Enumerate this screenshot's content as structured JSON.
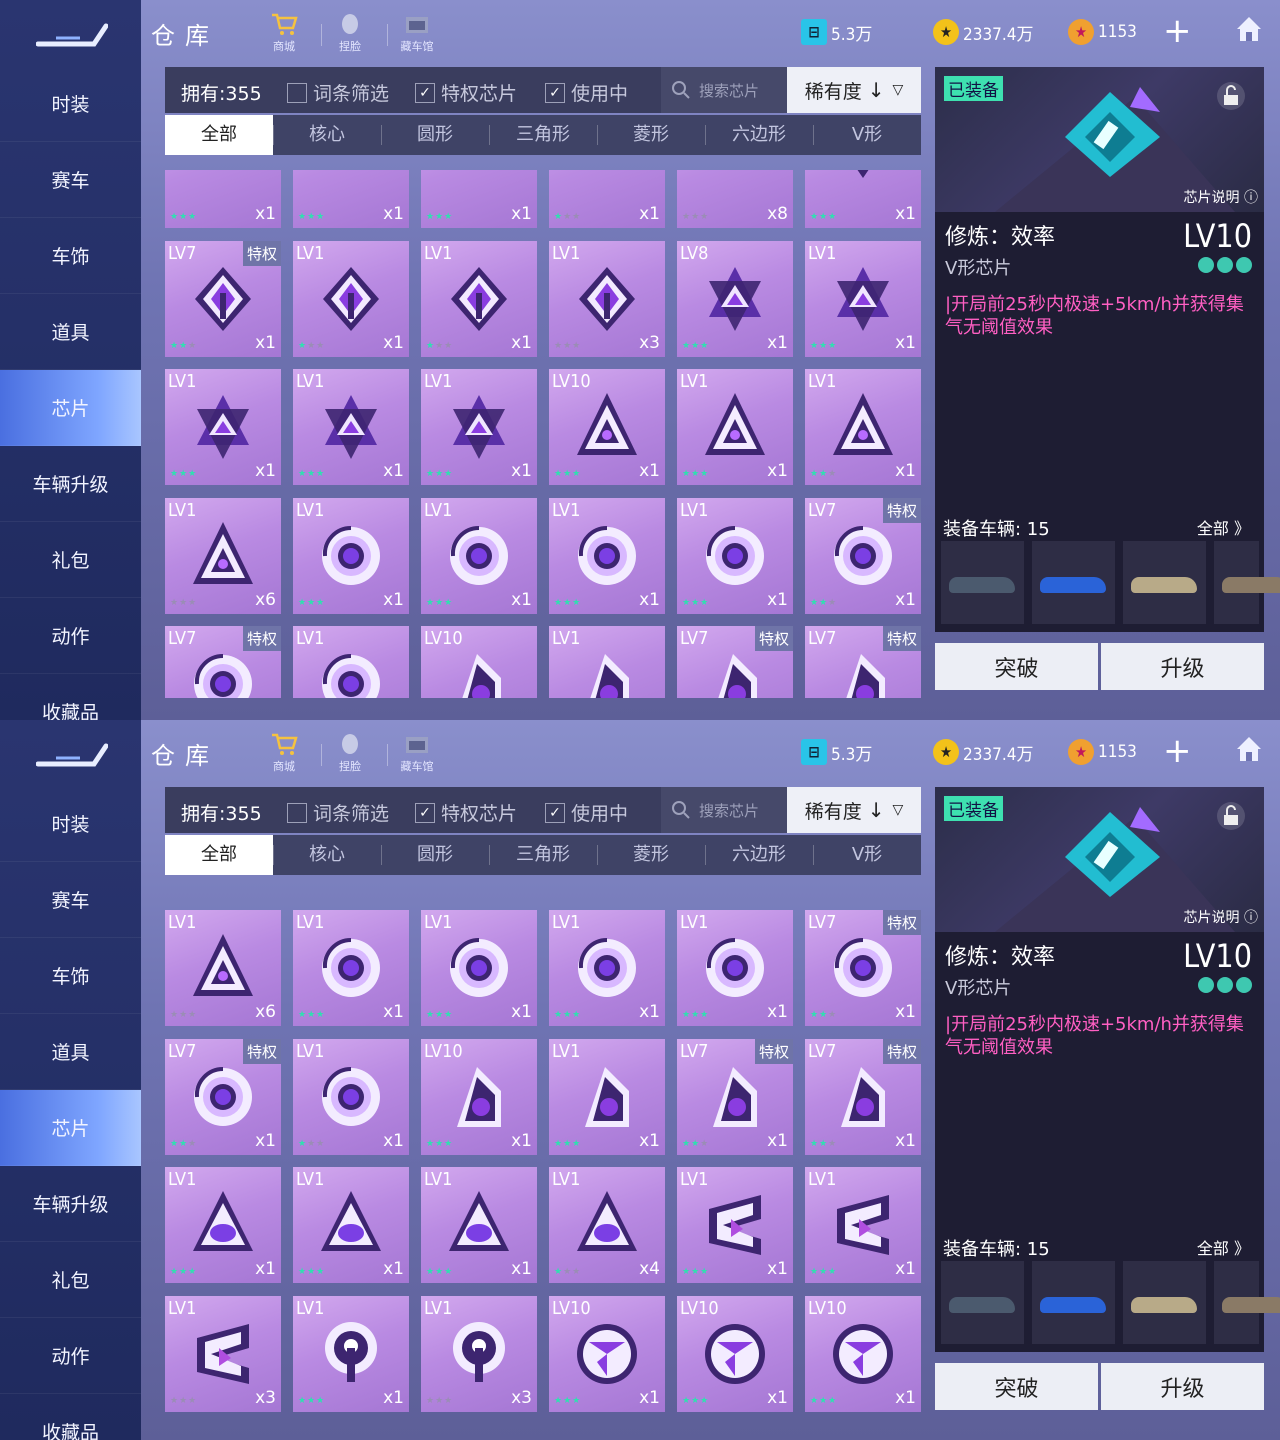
{
  "sidebar": {
    "items": [
      "时装",
      "赛车",
      "车饰",
      "道具",
      "芯片",
      "车辆升级",
      "礼包",
      "动作",
      "收藏品"
    ],
    "active_index": 4
  },
  "header": {
    "title": "仓库",
    "nav": [
      {
        "label": "商城",
        "icon": "shop-cart-icon"
      },
      {
        "label": "捏脸",
        "icon": "face-icon"
      },
      {
        "label": "藏车馆",
        "icon": "garage-icon"
      }
    ],
    "currencies": [
      {
        "value": "5.3万",
        "icon": "ticket-icon",
        "color": "#29c4e8"
      },
      {
        "value": "2337.4万",
        "icon": "coin-icon",
        "color": "#f3c21a"
      },
      {
        "value": "1153",
        "icon": "gem-icon",
        "color": "#f0a030"
      }
    ],
    "plus_icon": "plus-icon",
    "home_icon": "home-icon"
  },
  "filters": {
    "owned": "拥有:355",
    "keyword": "词条筛选",
    "privilege": "特权芯片",
    "in_use": "使用中",
    "keyword_checked": false,
    "privilege_checked": true,
    "in_use_checked": true,
    "search_placeholder": "搜索芯片",
    "sort": "稀有度"
  },
  "tabs": {
    "items": [
      "全部",
      "核心",
      "圆形",
      "三角形",
      "菱形",
      "六边形",
      "V形"
    ],
    "active_index": 0
  },
  "detail": {
    "equipped": "已装备",
    "chip_note": "芯片说明",
    "name": "修炼：效率",
    "level": "LV10",
    "type": "V形芯片",
    "rarity_stars": 3,
    "description": "|开局前25秒内极速+5km/h并获得集气无阈值效果",
    "vehicles_label": "装备车辆: 15",
    "vehicles_all": "全部 》",
    "vehicles": [
      {
        "color": "#4b5a6e"
      },
      {
        "color": "#2a63d8"
      },
      {
        "color": "#b8aa88"
      },
      {
        "color": "#8a7a66"
      }
    ],
    "break_button": "突破",
    "upgrade_button": "升级"
  },
  "grid_a": [
    {
      "lv": "",
      "tq": "",
      "cnt": "x1",
      "shape": "bars",
      "stars": [
        1,
        1,
        1
      ]
    },
    {
      "lv": "",
      "tq": "",
      "cnt": "x1",
      "shape": "bars",
      "stars": [
        1,
        1,
        1
      ]
    },
    {
      "lv": "",
      "tq": "",
      "cnt": "x1",
      "shape": "bars",
      "stars": [
        1,
        1,
        1
      ]
    },
    {
      "lv": "",
      "tq": "",
      "cnt": "x1",
      "shape": "bars",
      "stars": [
        1,
        0,
        0
      ]
    },
    {
      "lv": "",
      "tq": "",
      "cnt": "x8",
      "shape": "bars",
      "stars": [
        0,
        0,
        0
      ]
    },
    {
      "lv": "",
      "tq": "",
      "cnt": "x1",
      "shape": "vshape",
      "stars": [
        1,
        1,
        1
      ]
    },
    {
      "lv": "LV7",
      "tq": "特权",
      "cnt": "x1",
      "shape": "diamond",
      "stars": [
        1,
        1,
        0
      ]
    },
    {
      "lv": "LV1",
      "tq": "",
      "cnt": "x1",
      "shape": "diamond",
      "stars": [
        1,
        0,
        0
      ]
    },
    {
      "lv": "LV1",
      "tq": "",
      "cnt": "x1",
      "shape": "diamond",
      "stars": [
        1,
        0,
        0
      ]
    },
    {
      "lv": "LV1",
      "tq": "",
      "cnt": "x3",
      "shape": "diamond",
      "stars": [
        0,
        0,
        0
      ]
    },
    {
      "lv": "LV8",
      "tq": "",
      "cnt": "x1",
      "shape": "star",
      "stars": [
        1,
        1,
        1
      ]
    },
    {
      "lv": "LV1",
      "tq": "",
      "cnt": "x1",
      "shape": "star",
      "stars": [
        1,
        1,
        1
      ]
    },
    {
      "lv": "LV1",
      "tq": "",
      "cnt": "x1",
      "shape": "star",
      "stars": [
        1,
        1,
        1
      ]
    },
    {
      "lv": "LV1",
      "tq": "",
      "cnt": "x1",
      "shape": "star",
      "stars": [
        1,
        1,
        1
      ]
    },
    {
      "lv": "LV1",
      "tq": "",
      "cnt": "x1",
      "shape": "star",
      "stars": [
        1,
        1,
        1
      ]
    },
    {
      "lv": "LV10",
      "tq": "",
      "cnt": "x1",
      "shape": "tri",
      "stars": [
        1,
        1,
        1
      ]
    },
    {
      "lv": "LV1",
      "tq": "",
      "cnt": "x1",
      "shape": "tri",
      "stars": [
        1,
        1,
        1
      ]
    },
    {
      "lv": "LV1",
      "tq": "",
      "cnt": "x1",
      "shape": "tri",
      "stars": [
        1,
        1,
        0
      ]
    },
    {
      "lv": "LV1",
      "tq": "",
      "cnt": "x6",
      "shape": "tri",
      "stars": [
        0,
        0,
        0
      ]
    },
    {
      "lv": "LV1",
      "tq": "",
      "cnt": "x1",
      "shape": "swirl",
      "stars": [
        1,
        1,
        1
      ]
    },
    {
      "lv": "LV1",
      "tq": "",
      "cnt": "x1",
      "shape": "swirl",
      "stars": [
        1,
        1,
        1
      ]
    },
    {
      "lv": "LV1",
      "tq": "",
      "cnt": "x1",
      "shape": "swirl",
      "stars": [
        1,
        1,
        1
      ]
    },
    {
      "lv": "LV1",
      "tq": "",
      "cnt": "x1",
      "shape": "swirl",
      "stars": [
        1,
        1,
        1
      ]
    },
    {
      "lv": "LV7",
      "tq": "特权",
      "cnt": "x1",
      "shape": "swirl",
      "stars": [
        1,
        1,
        0
      ]
    },
    {
      "lv": "LV7",
      "tq": "特权",
      "cnt": "",
      "shape": "swirl",
      "stars": []
    },
    {
      "lv": "LV1",
      "tq": "",
      "cnt": "",
      "shape": "swirl",
      "stars": []
    },
    {
      "lv": "LV10",
      "tq": "",
      "cnt": "",
      "shape": "wing",
      "stars": []
    },
    {
      "lv": "LV1",
      "tq": "",
      "cnt": "",
      "shape": "wing",
      "stars": []
    },
    {
      "lv": "LV7",
      "tq": "特权",
      "cnt": "",
      "shape": "wing",
      "stars": []
    },
    {
      "lv": "LV7",
      "tq": "特权",
      "cnt": "",
      "shape": "wing",
      "stars": []
    }
  ],
  "grid_b": [
    {
      "lv": "LV1",
      "tq": "",
      "cnt": "x6",
      "shape": "tri",
      "stars": [
        0,
        0,
        0
      ]
    },
    {
      "lv": "LV1",
      "tq": "",
      "cnt": "x1",
      "shape": "swirl",
      "stars": [
        1,
        1,
        1
      ]
    },
    {
      "lv": "LV1",
      "tq": "",
      "cnt": "x1",
      "shape": "swirl",
      "stars": [
        1,
        1,
        1
      ]
    },
    {
      "lv": "LV1",
      "tq": "",
      "cnt": "x1",
      "shape": "swirl",
      "stars": [
        1,
        1,
        1
      ]
    },
    {
      "lv": "LV1",
      "tq": "",
      "cnt": "x1",
      "shape": "swirl",
      "stars": [
        1,
        1,
        1
      ]
    },
    {
      "lv": "LV7",
      "tq": "特权",
      "cnt": "x1",
      "shape": "swirl",
      "stars": [
        1,
        1,
        0
      ]
    },
    {
      "lv": "LV7",
      "tq": "特权",
      "cnt": "x1",
      "shape": "swirl",
      "stars": [
        1,
        1,
        0
      ]
    },
    {
      "lv": "LV1",
      "tq": "",
      "cnt": "x1",
      "shape": "swirl",
      "stars": [
        1,
        0,
        0
      ]
    },
    {
      "lv": "LV10",
      "tq": "",
      "cnt": "x1",
      "shape": "wing",
      "stars": [
        1,
        1,
        1
      ]
    },
    {
      "lv": "LV1",
      "tq": "",
      "cnt": "x1",
      "shape": "wing",
      "stars": [
        1,
        1,
        1
      ]
    },
    {
      "lv": "LV7",
      "tq": "特权",
      "cnt": "x1",
      "shape": "wing",
      "stars": [
        1,
        1,
        0
      ]
    },
    {
      "lv": "LV7",
      "tq": "特权",
      "cnt": "x1",
      "shape": "wing",
      "stars": [
        1,
        1,
        0
      ]
    },
    {
      "lv": "LV1",
      "tq": "",
      "cnt": "x1",
      "shape": "triball",
      "stars": [
        1,
        1,
        1
      ]
    },
    {
      "lv": "LV1",
      "tq": "",
      "cnt": "x1",
      "shape": "triball",
      "stars": [
        1,
        1,
        1
      ]
    },
    {
      "lv": "LV1",
      "tq": "",
      "cnt": "x1",
      "shape": "triball",
      "stars": [
        1,
        1,
        1
      ]
    },
    {
      "lv": "LV1",
      "tq": "",
      "cnt": "x4",
      "shape": "triball",
      "stars": [
        1,
        0,
        0
      ]
    },
    {
      "lv": "LV1",
      "tq": "",
      "cnt": "x1",
      "shape": "zig",
      "stars": [
        1,
        1,
        1
      ]
    },
    {
      "lv": "LV1",
      "tq": "",
      "cnt": "x1",
      "shape": "zig",
      "stars": [
        1,
        1,
        1
      ]
    },
    {
      "lv": "LV1",
      "tq": "",
      "cnt": "x3",
      "shape": "zig",
      "stars": [
        0,
        0,
        0
      ]
    },
    {
      "lv": "LV1",
      "tq": "",
      "cnt": "x1",
      "shape": "ring",
      "stars": [
        1,
        1,
        1
      ]
    },
    {
      "lv": "LV1",
      "tq": "",
      "cnt": "x3",
      "shape": "ring",
      "stars": [
        0,
        0,
        0
      ]
    },
    {
      "lv": "LV10",
      "tq": "",
      "cnt": "x1",
      "shape": "orb",
      "stars": [
        1,
        1,
        1
      ]
    },
    {
      "lv": "LV10",
      "tq": "",
      "cnt": "x1",
      "shape": "orb",
      "stars": [
        1,
        1,
        1
      ]
    },
    {
      "lv": "LV10",
      "tq": "",
      "cnt": "x1",
      "shape": "orb",
      "stars": [
        1,
        1,
        1
      ]
    }
  ]
}
